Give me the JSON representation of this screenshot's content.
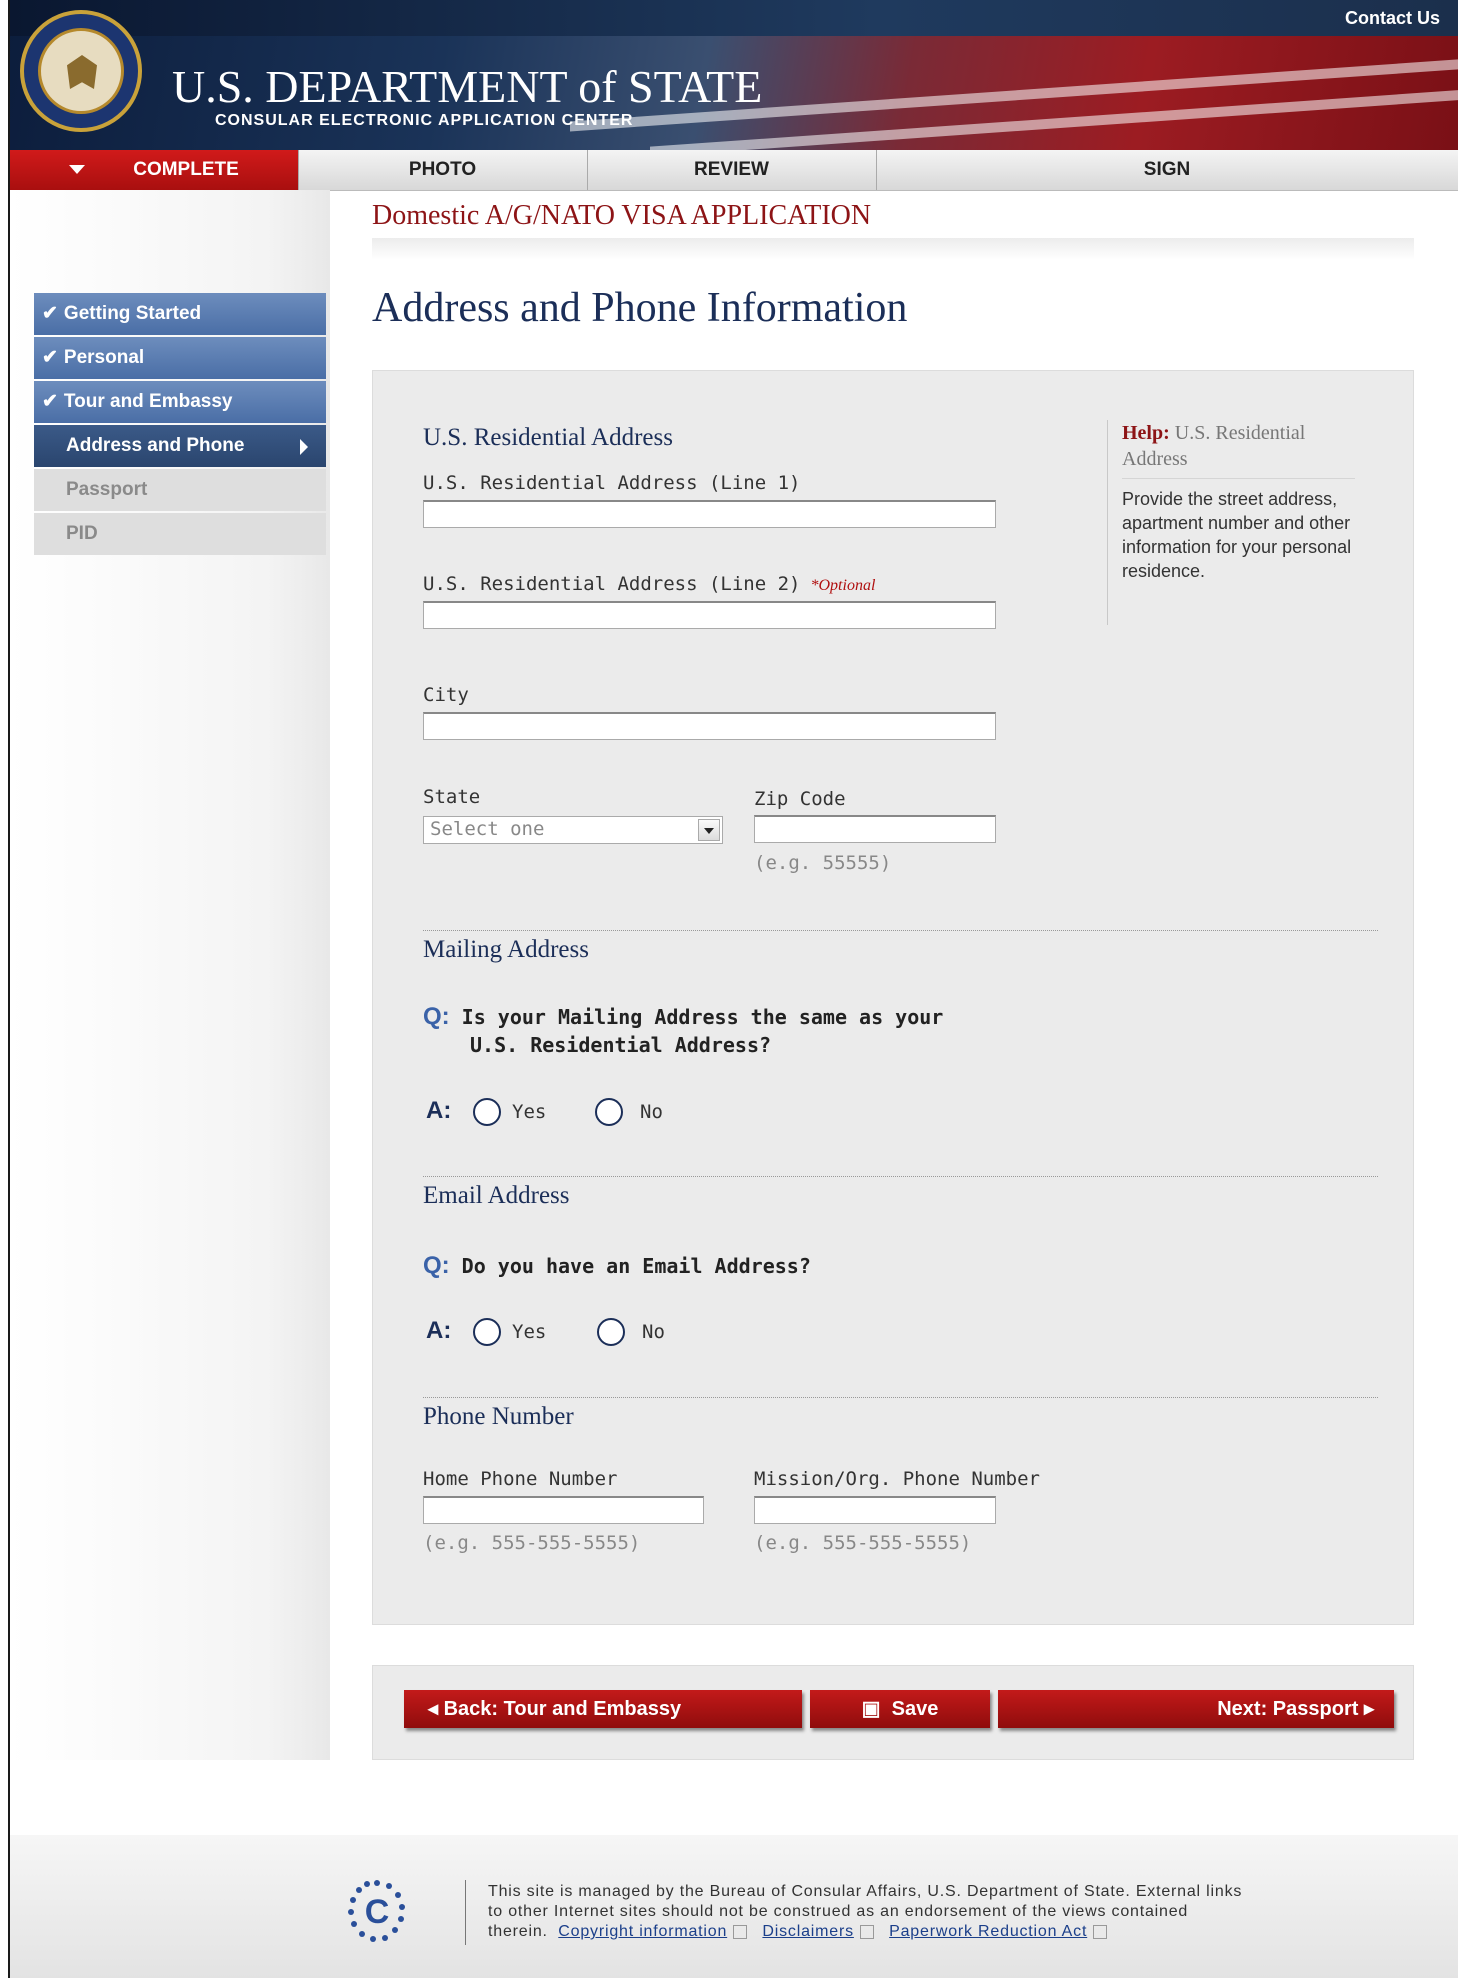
{
  "header": {
    "contact_label": "Contact Us",
    "title": "U.S. DEPARTMENT of STATE",
    "subtitle": "CONSULAR ELECTRONIC APPLICATION CENTER"
  },
  "tabs": [
    {
      "label": "COMPLETE",
      "active": true
    },
    {
      "label": "PHOTO",
      "active": false
    },
    {
      "label": "REVIEW",
      "active": false
    },
    {
      "label": "SIGN",
      "active": false
    }
  ],
  "app_title": "Domestic A/G/NATO VISA APPLICATION",
  "sidebar": {
    "items": [
      {
        "label": "Getting Started",
        "state": "done"
      },
      {
        "label": "Personal",
        "state": "done"
      },
      {
        "label": "Tour and Embassy",
        "state": "done"
      },
      {
        "label": "Address and Phone",
        "state": "current"
      },
      {
        "label": "Passport",
        "state": "todo"
      },
      {
        "label": "PID",
        "state": "todo"
      }
    ],
    "check_glyph": "✔"
  },
  "page_title": "Address and Phone Information",
  "residential": {
    "heading": "U.S. Residential Address",
    "line1_label": "U.S. Residential Address (Line 1)",
    "line1_value": "",
    "line2_label": "U.S. Residential Address (Line 2)",
    "line2_value": "",
    "optional_tag": "*Optional",
    "city_label": "City",
    "city_value": "",
    "state_label": "State",
    "state_selected": "Select one",
    "zip_label": "Zip Code",
    "zip_value": "",
    "zip_hint": "(e.g. 55555)"
  },
  "help": {
    "prefix": "Help:",
    "topic": "U.S. Residential Address",
    "text": "Provide the street address, apartment number and other information for your personal residence."
  },
  "mailing": {
    "heading": "Mailing Address",
    "q_mark": "Q:",
    "question_line1": "Is your Mailing Address the same as your",
    "question_line2": "U.S. Residential Address?",
    "a_mark": "A:",
    "yes": "Yes",
    "no": "No"
  },
  "email": {
    "heading": "Email Address",
    "q_mark": "Q:",
    "question": "Do you have an Email Address?",
    "a_mark": "A:",
    "yes": "Yes",
    "no": "No"
  },
  "phone": {
    "heading": "Phone Number",
    "home_label": "Home Phone Number",
    "home_value": "",
    "home_hint": "(e.g. 555-555-5555)",
    "mission_label": "Mission/Org. Phone Number",
    "mission_value": "",
    "mission_hint": "(e.g. 555-555-5555)"
  },
  "buttons": {
    "back": "Back:  Tour and Embassy",
    "save": "Save",
    "next": "Next: Passport"
  },
  "footer": {
    "text_line1": "This site is managed by the Bureau of Consular Affairs, U.S. Department of State. External links",
    "text_line2": "to other Internet sites should not be construed as an endorsement of the views contained",
    "text_line3": "therein.",
    "links": [
      "Copyright information",
      "Disclaimers",
      "Paperwork Reduction Act"
    ]
  },
  "colors": {
    "brand_red": "#a90f0f",
    "navy": "#1b2e58",
    "nav_blue": "#4a6ea6"
  }
}
